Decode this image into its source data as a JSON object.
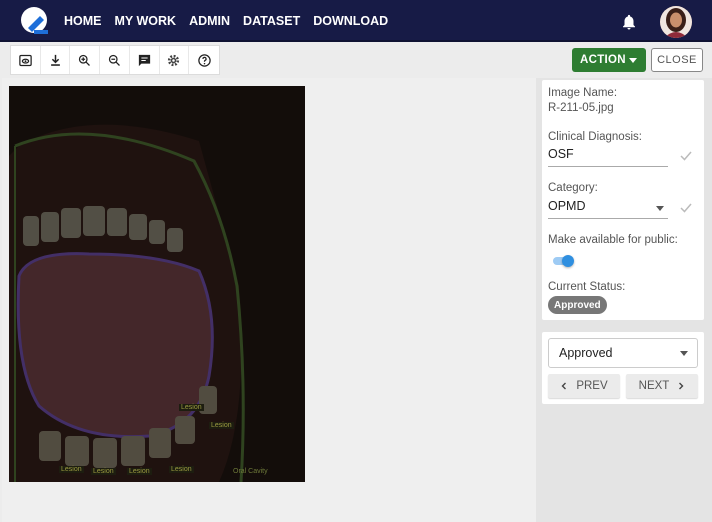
{
  "nav": {
    "items": [
      "HOME",
      "MY WORK",
      "ADMIN",
      "DATASET",
      "DOWNLOAD"
    ]
  },
  "toolbar": {
    "tools": [
      "eye-icon",
      "download-icon",
      "zoom-in-icon",
      "zoom-out-icon",
      "comment-icon",
      "settings-icon",
      "help-icon"
    ]
  },
  "actions": {
    "action_label": "ACTION",
    "close_label": "CLOSE",
    "action_color": "#2e7d32"
  },
  "image": {
    "annotation_labels": [
      "Lesion",
      "Lesion",
      "Lesion",
      "Lesion",
      "Lesion",
      "Lesion",
      "Oral Cavity"
    ]
  },
  "details": {
    "image_name_label": "Image Name:",
    "image_name": "R-211-05.jpg",
    "diagnosis_label": "Clinical Diagnosis:",
    "diagnosis": "OSF",
    "category_label": "Category:",
    "category": "OPMD",
    "public_label": "Make available for public:",
    "public": true,
    "status_label": "Current Status:",
    "status": "Approved"
  },
  "review": {
    "selected": "Approved",
    "prev_label": "PREV",
    "next_label": "NEXT"
  }
}
